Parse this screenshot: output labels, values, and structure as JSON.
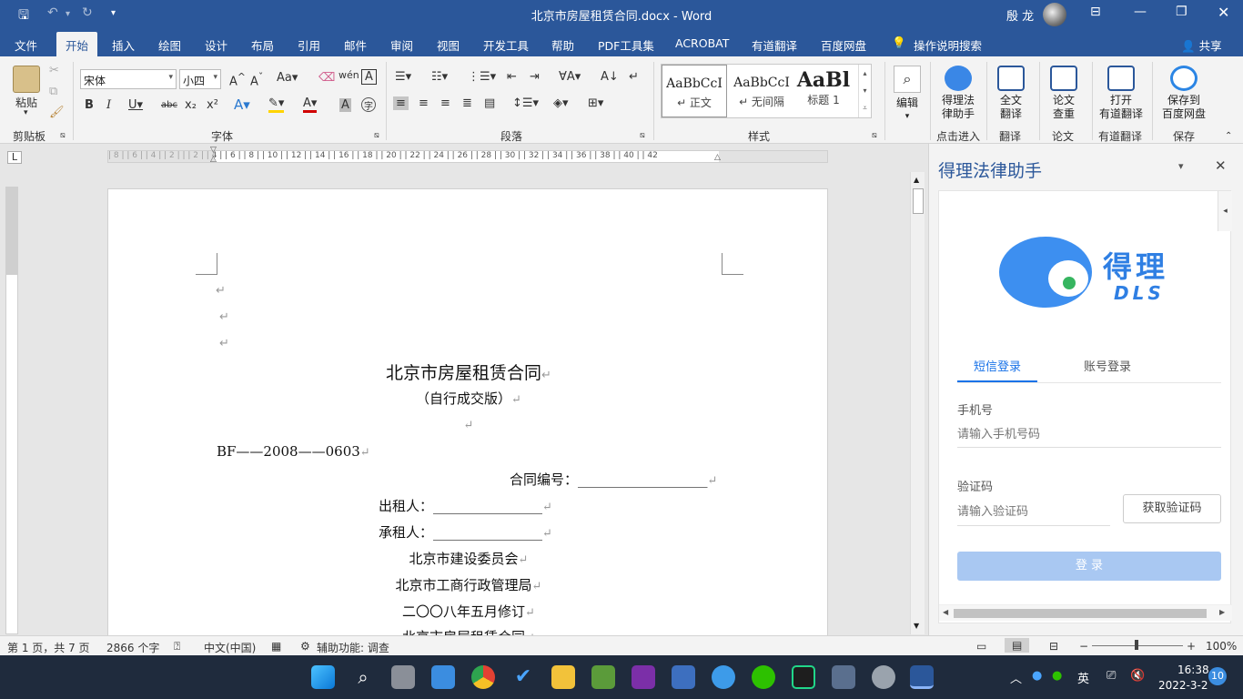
{
  "window": {
    "title": "北京市房屋租赁合同.docx  -  Word",
    "user": "殷 龙"
  },
  "tabs": [
    "文件",
    "开始",
    "插入",
    "绘图",
    "设计",
    "布局",
    "引用",
    "邮件",
    "审阅",
    "视图",
    "开发工具",
    "帮助",
    "PDF工具集",
    "ACROBAT",
    "有道翻译",
    "百度网盘"
  ],
  "tell_me": "操作说明搜索",
  "share": "共享",
  "ribbon": {
    "paste": "粘贴",
    "font_name": "宋体",
    "font_size": "小四",
    "styles": [
      {
        "preview": "AaBbCcI",
        "name": "↵ 正文"
      },
      {
        "preview": "AaBbCcI",
        "name": "↵ 无间隔"
      },
      {
        "preview": "AaBl",
        "name": "标题 1"
      }
    ],
    "edit": "编辑",
    "buttons": [
      {
        "l1": "得理法",
        "l2": "律助手",
        "group": "点击进入"
      },
      {
        "l1": "全文",
        "l2": "翻译",
        "group": "翻译"
      },
      {
        "l1": "论文",
        "l2": "查重",
        "group": "论文"
      },
      {
        "l1": "打开",
        "l2": "有道翻译",
        "group": "有道翻译"
      },
      {
        "l1": "保存到",
        "l2": "百度网盘",
        "group": "保存"
      }
    ],
    "groups": {
      "clipboard": "剪贴板",
      "font": "字体",
      "paragraph": "段落",
      "styles": "样式"
    }
  },
  "ruler_h": "| 8 |  | 6 |  | 4 |  | 2 |   |    | 2 |  | 4 |  | 6 |  | 8 |  | 10 |  | 12 |  | 14 |  | 16 |  | 18 |  | 20 |  | 22 |  | 24 |  | 26 |  | 28 |  | 30 |  | 32 |  | 34 |  | 36 |  | 38 |  | 40 |  | 42",
  "doc": {
    "title": "北京市房屋租赁合同",
    "subtitle": "（自行成交版）",
    "code": "BF——2008——0603",
    "contract_no": "合同编号：___________________",
    "lessor": "出租人：________________",
    "lessee": "承租人：________________",
    "org1": "北京市建设委员会",
    "org2": "北京市工商行政管理局",
    "date": "二〇〇八年五月修订",
    "more": "北京市房屋租赁合同"
  },
  "pane": {
    "title": "得理法律助手",
    "logo_cn": "得理",
    "logo_en": "DLS",
    "tab_sms": "短信登录",
    "tab_account": "账号登录",
    "phone_label": "手机号",
    "phone_ph": "请输入手机号码",
    "code_label": "验证码",
    "code_ph": "请输入验证码",
    "get_code": "获取验证码",
    "login": "登 录",
    "colors": {
      "accent": "#2b579a",
      "blue": "#1a73e8",
      "login_bg": "#a9c8f2"
    }
  },
  "status": {
    "page": "第 1 页，共 7 页",
    "words": "2866 个字",
    "lang": "中文(中国)",
    "access": "辅助功能: 调查",
    "zoom": "100%"
  },
  "tray": {
    "ime": "英",
    "time": "16:38",
    "date": "2022-3-2",
    "badge": "10"
  }
}
